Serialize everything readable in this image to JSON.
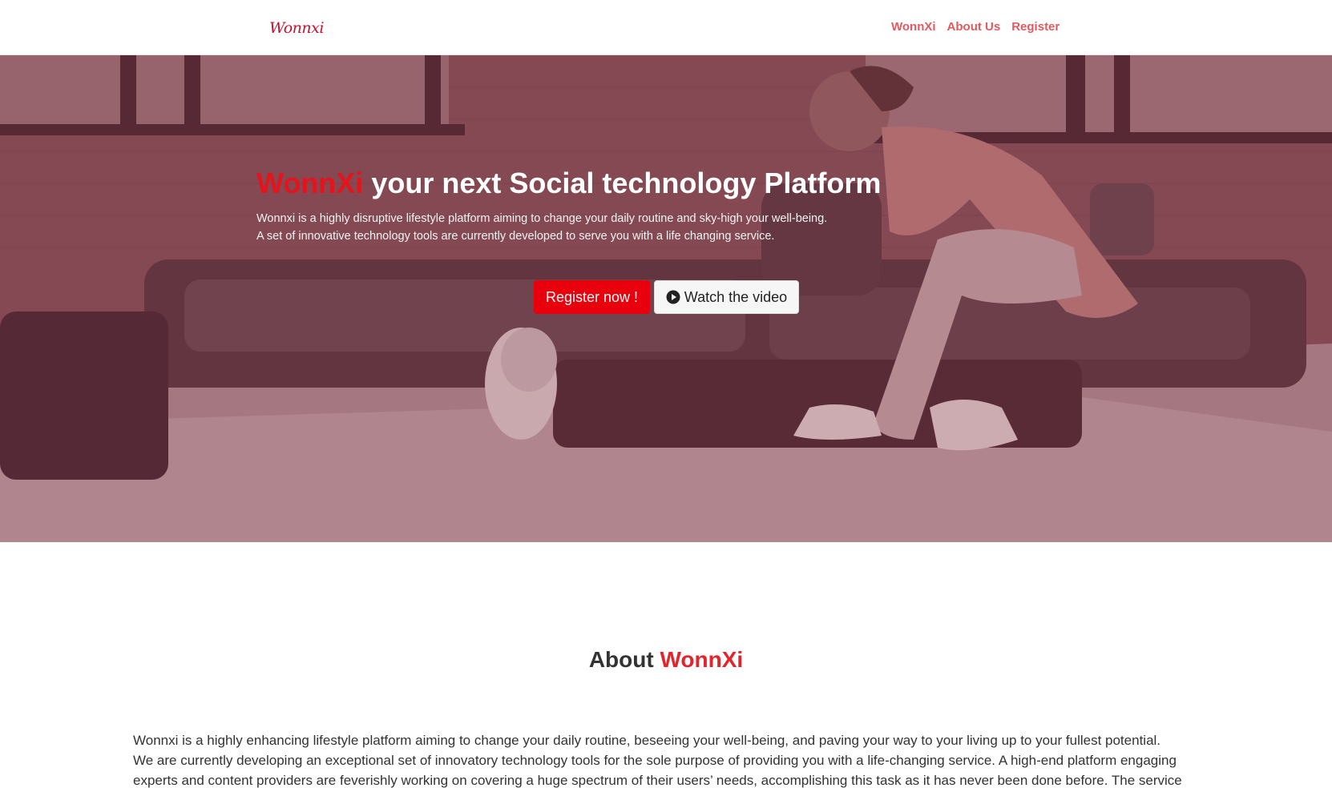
{
  "nav": {
    "logo_text": "Wonnxi",
    "links": [
      "WonnXi",
      "About Us",
      "Register"
    ]
  },
  "hero": {
    "title_brand": "WonnXi",
    "title_rest": " your next Social technology Platform",
    "line1": "Wonnxi is a highly disruptive lifestyle platform aiming to change your daily routine and sky-high your well-being.",
    "line2": "A set of innovative technology tools are currently developed to serve you with a life changing service.",
    "register_label": "Register now !",
    "video_label": "Watch the video"
  },
  "about": {
    "title_prefix": "About ",
    "title_brand": "WonnXi",
    "para1": "Wonnxi is a highly enhancing lifestyle platform aiming to change your daily routine, beseeing your well-being, and paving your way to your living up to your fullest potential.",
    "para2": "We are currently developing an exceptional set of innovatory technology tools for the sole purpose of providing you with a life-changing service. A high-end platform engaging",
    "para3": "experts and content providers are feverishly working on covering a huge spectrum of their users’ needs, accomplishing this task as it has never been done before. The service"
  },
  "colors": {
    "brand_red": "#e3141b",
    "nav_link": "#e05a5f",
    "register_button": "#e8000c"
  },
  "icons": [
    "play-circle-icon"
  ]
}
